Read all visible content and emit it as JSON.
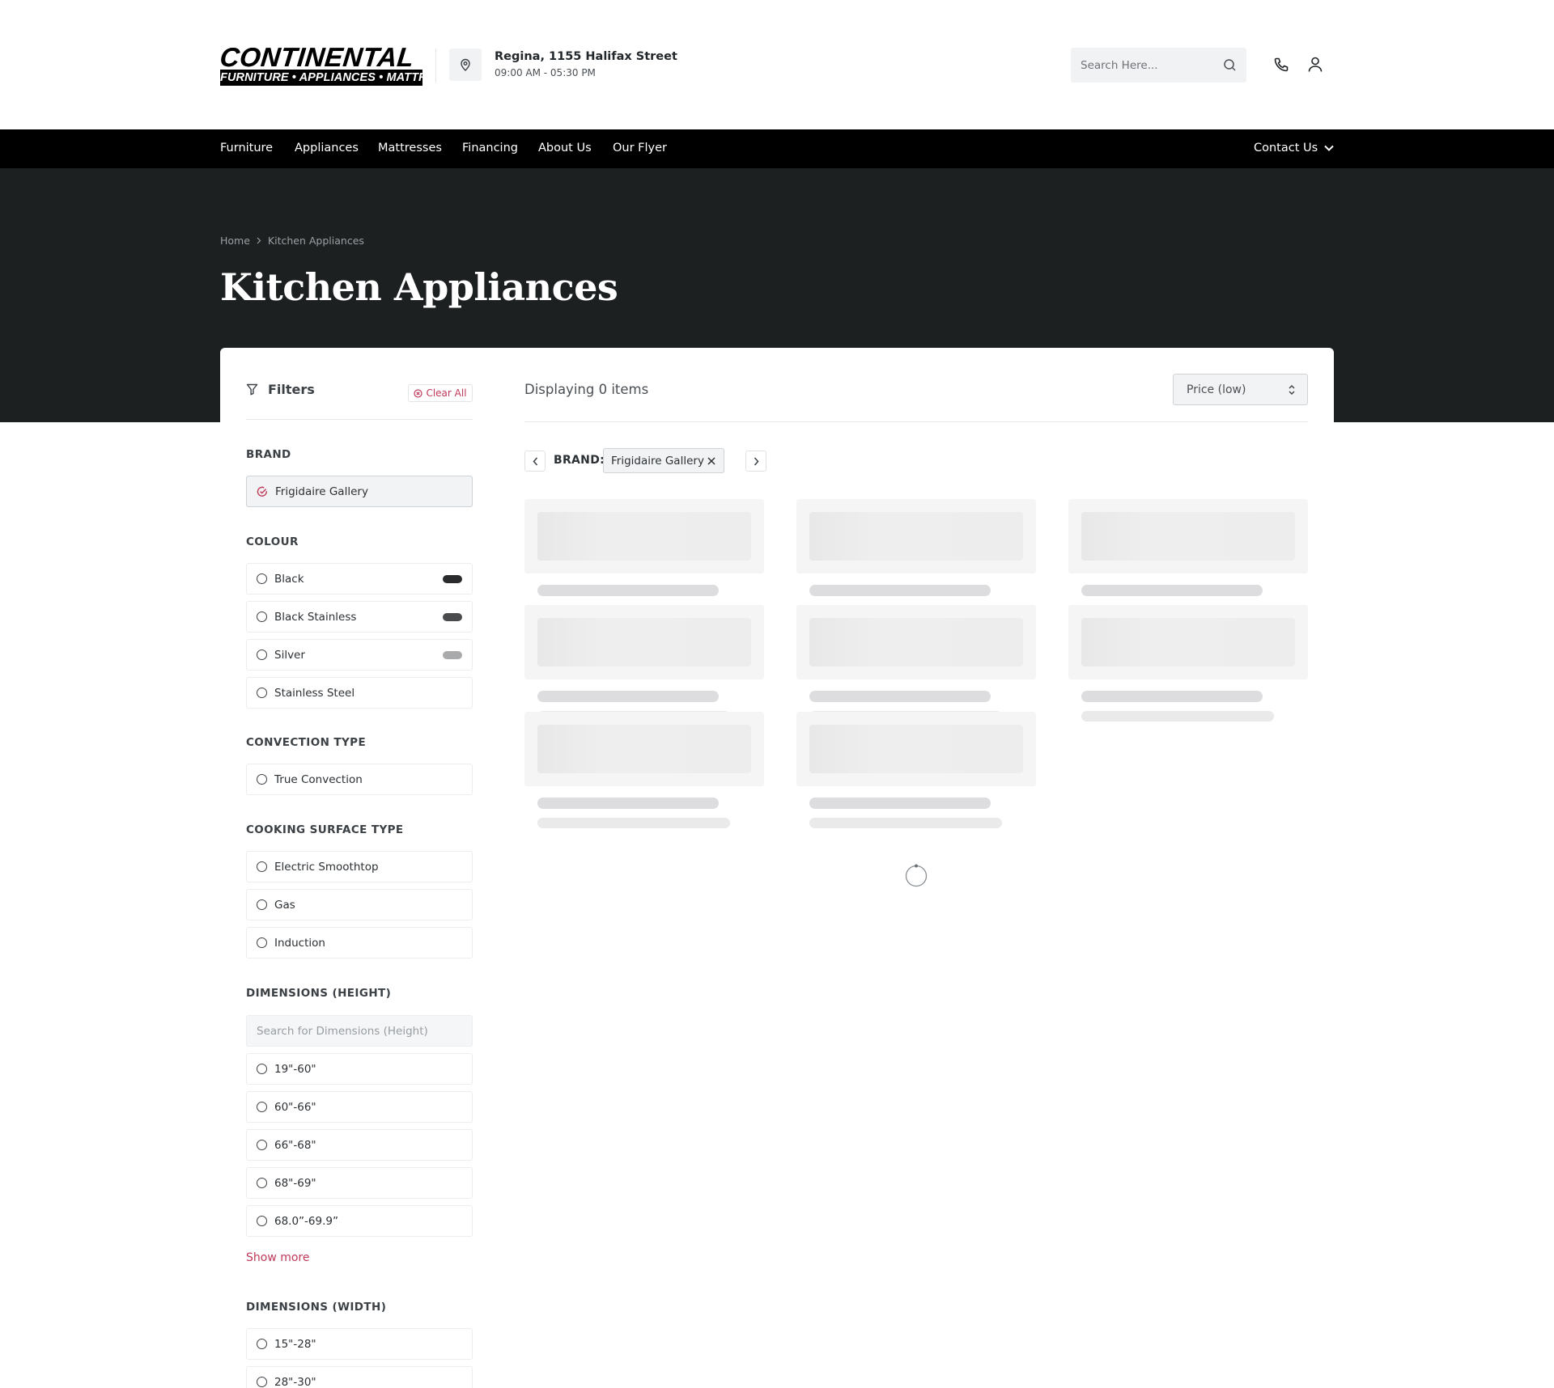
{
  "header": {
    "logo": {
      "top_text": "CONTINENTAL",
      "bottom_text": "FURNITURE • APPLIANCES • MATTRESSES"
    },
    "location": {
      "icon": "map-pin-icon",
      "address": "Regina, 1155 Halifax Street",
      "hours": "09:00 AM - 05:30 PM"
    },
    "search": {
      "placeholder": "Search Here...",
      "value": "",
      "icon": "search-icon"
    },
    "icons": [
      "phone-icon",
      "user-icon"
    ]
  },
  "nav": {
    "items": [
      {
        "label": "Furniture"
      },
      {
        "label": "Appliances"
      },
      {
        "label": "Mattresses"
      },
      {
        "label": "Financing"
      },
      {
        "label": "About Us"
      },
      {
        "label": "Our Flyer"
      }
    ],
    "contact_label": "Contact Us"
  },
  "hero": {
    "breadcrumb": [
      "Home",
      "Kitchen Appliances"
    ],
    "title": "Kitchen Appliances"
  },
  "filters": {
    "title": "Filters",
    "clear_all": "Clear All",
    "sections": [
      {
        "title": "BRAND",
        "options": [
          {
            "label": "Frigidaire Gallery",
            "selected": true
          }
        ]
      },
      {
        "title": "COLOUR",
        "options": [
          {
            "label": "Black",
            "swatch": "#2a2b2d"
          },
          {
            "label": "Black Stainless",
            "swatch": "#4a4b4d"
          },
          {
            "label": "Silver",
            "swatch": "#a9aaab"
          },
          {
            "label": "Stainless Steel"
          }
        ]
      },
      {
        "title": "CONVECTION TYPE",
        "options": [
          {
            "label": "True Convection"
          }
        ]
      },
      {
        "title": "COOKING SURFACE TYPE",
        "options": [
          {
            "label": "Electric Smoothtop"
          },
          {
            "label": "Gas"
          },
          {
            "label": "Induction"
          }
        ]
      },
      {
        "title": "DIMENSIONS (HEIGHT)",
        "search_placeholder": "Search for Dimensions (Height)",
        "options": [
          {
            "label": "19\"-60\""
          },
          {
            "label": "60\"-66\""
          },
          {
            "label": "66\"-68\""
          },
          {
            "label": "68\"-69\""
          },
          {
            "label": "68.0”-69.9”"
          }
        ],
        "show_more": "Show more"
      },
      {
        "title": "DIMENSIONS (WIDTH)",
        "options": [
          {
            "label": "15\"-28\""
          },
          {
            "label": "28\"-30\""
          }
        ]
      }
    ]
  },
  "results": {
    "count_text": "Displaying 0 items",
    "sort": {
      "selected": "Price (low)"
    },
    "active_filter": {
      "label": "BRAND:",
      "value": "Frigidaire Gallery"
    }
  },
  "colors": {
    "accent": "#c0395a",
    "nav_bg": "#000000",
    "hero_bg": "#1c2021"
  }
}
